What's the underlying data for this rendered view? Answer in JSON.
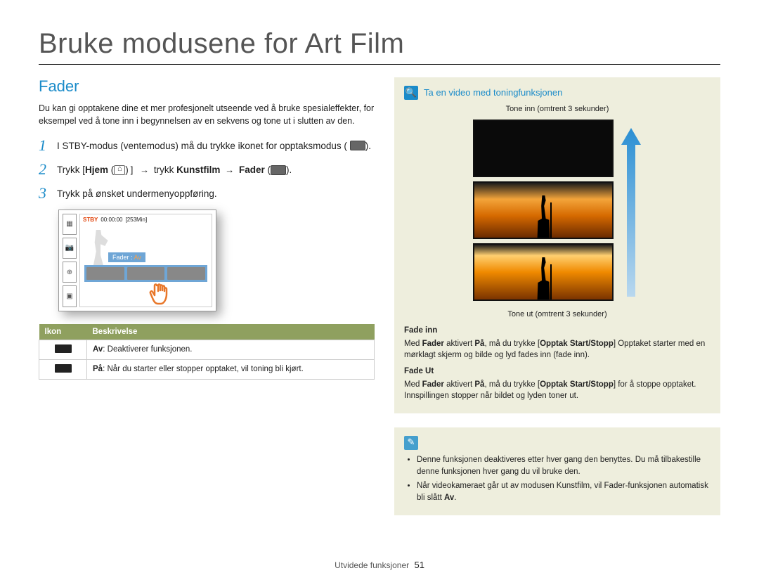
{
  "title": "Bruke modusene for Art Film",
  "left": {
    "section_title": "Fader",
    "intro": "Du kan gi opptakene dine et mer profesjonelt utseende ved å bruke spesialeffekter, for eksempel ved å tone inn i begynnelsen av en sekvens og tone ut i slutten av den.",
    "steps": {
      "s1": "I STBY-modus (ventemodus) må du trykke ikonet for opptaksmodus (",
      "s1_tail": ").",
      "s2_pre": "Trykk [",
      "s2_hjem": "Hjem",
      "s2_mid": "] → trykk ",
      "s2_kunst": "Kunstfilm",
      "s2_arrow": " → ",
      "s2_fader": "Fader",
      "s2_tail": " (",
      "s2_end": ").",
      "s3": "Trykk på ønsket undermenyoppføring."
    },
    "lcd": {
      "stby": "STBY",
      "time": "00:00:00",
      "dur": "[253Min]",
      "fader_label": "Fader :",
      "fader_val": "Av"
    },
    "table": {
      "head_icon": "Ikon",
      "head_desc": "Beskrivelse",
      "row1_label": "Av",
      "row1_text": ": Deaktiverer funksjonen.",
      "row2_label": "På",
      "row2_text": ": Når du starter eller stopper opptaket, vil toning bli kjørt."
    }
  },
  "right": {
    "panel1_title": "Ta en video med toningfunksjonen",
    "tone_in": "Tone inn (omtrent 3 sekunder)",
    "tone_out": "Tone ut (omtrent 3 sekunder)",
    "fade_in_h": "Fade inn",
    "fade_in_p_pre": "Med ",
    "fade_in_p_fader": "Fader",
    "fade_in_p_mid": " aktivert ",
    "fade_in_p_pa": "På",
    "fade_in_p_mid2": ", må du trykke [",
    "fade_in_p_btn": "Opptak Start/Stopp",
    "fade_in_p_tail": "] Opptaket starter med en mørklagt skjerm og bilde og lyd fades inn (fade inn).",
    "fade_out_h": "Fade Ut",
    "fade_out_p_tail": "] for å stoppe opptaket. Innspillingen stopper når bildet og lyden toner ut.",
    "note1": "Denne funksjonen deaktiveres etter hver gang den benyttes. Du må tilbakestille denne funksjonen hver gang du vil bruke den.",
    "note2_pre": "Når videokameraet går ut av modusen Kunstfilm, vil Fader-funksjonen automatisk bli slått ",
    "note2_av": "Av",
    "note2_tail": "."
  },
  "footer": {
    "section": "Utvidede funksjoner",
    "page": "51"
  }
}
